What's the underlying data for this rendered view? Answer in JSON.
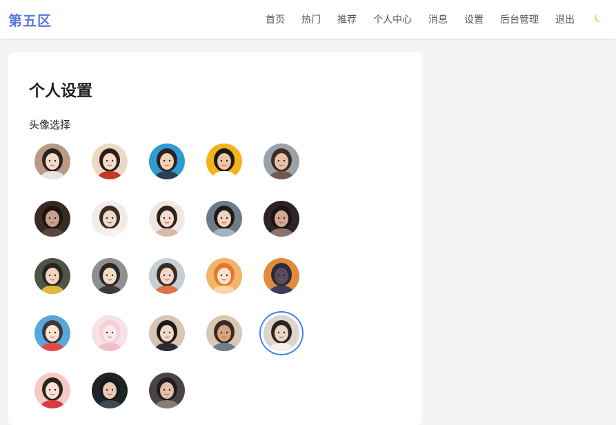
{
  "brand": "第五区",
  "nav": {
    "items": [
      "首页",
      "热门",
      "推荐",
      "个人中心",
      "消息",
      "设置",
      "后台管理",
      "退出"
    ],
    "theme_icon": "moon-icon"
  },
  "settings": {
    "title": "个人设置",
    "avatar_label": "头像选择",
    "selected_index": 19,
    "avatars": [
      {
        "icon": "avatar-girl-illustration",
        "bg": "#b89a86",
        "skin": "#f3dccb",
        "hair": "#2b2220",
        "shirt": "#e8e4e0"
      },
      {
        "icon": "avatar-girl-red-dress",
        "bg": "#ecd9c4",
        "skin": "#f5dcc8",
        "hair": "#2a1f1c",
        "shirt": "#c0392b"
      },
      {
        "icon": "avatar-boy-glasses",
        "bg": "#2f9bd0",
        "skin": "#f1d3b7",
        "hair": "#2a2322",
        "shirt": "#2c3e50"
      },
      {
        "icon": "avatar-man-yellow",
        "bg": "#f4b21b",
        "skin": "#e9c6a5",
        "hair": "#1b1b1b",
        "shirt": "#ffffff"
      },
      {
        "icon": "avatar-selfie",
        "bg": "#9aa1a8",
        "skin": "#e2c3a8",
        "hair": "#3d2b25",
        "shirt": "#6d5a52"
      },
      {
        "icon": "avatar-dark-girl",
        "bg": "#3a2a26",
        "skin": "#c9a190",
        "hair": "#1d1514",
        "shirt": "#5a4641"
      },
      {
        "icon": "avatar-girl-white",
        "bg": "#f2ece9",
        "skin": "#f1d9ca",
        "hair": "#3c2c28",
        "shirt": "#f7f2f0"
      },
      {
        "icon": "avatar-girl-smile",
        "bg": "#f0e6e2",
        "skin": "#f4dcd0",
        "hair": "#2e211e",
        "shirt": "#d7b9ab"
      },
      {
        "icon": "avatar-girl-outdoor",
        "bg": "#6f7c88",
        "skin": "#f0d2bf",
        "hair": "#1c1a1a",
        "shirt": "#a6b3c1"
      },
      {
        "icon": "avatar-girl-shadow",
        "bg": "#2d2423",
        "skin": "#d1aa96",
        "hair": "#1a1413",
        "shirt": "#8c7469"
      },
      {
        "icon": "avatar-girl-yellow",
        "bg": "#4d5548",
        "skin": "#f0d6bd",
        "hair": "#2a2420",
        "shirt": "#e0b93b"
      },
      {
        "icon": "avatar-boy-cartoon",
        "bg": "#8f9191",
        "skin": "#f1dcc8",
        "hair": "#2b2624",
        "shirt": "#3f3a39"
      },
      {
        "icon": "avatar-girl-flowers",
        "bg": "#c6cfd6",
        "skin": "#f2d6c6",
        "hair": "#3a2b25",
        "shirt": "#e0714b"
      },
      {
        "icon": "avatar-girl-orange-hair",
        "bg": "#f2b46b",
        "skin": "#fbe2c8",
        "hair": "#e2782b",
        "shirt": "#f7d7a8"
      },
      {
        "icon": "avatar-sunset",
        "bg": "#e08a3c",
        "skin": "#5a4a5a",
        "hair": "#2c2a3c",
        "shirt": "#3c3d59"
      },
      {
        "icon": "avatar-cartoon-kid",
        "bg": "#5aa7dc",
        "skin": "#fbe3cf",
        "hair": "#3a3a3a",
        "shirt": "#e54848"
      },
      {
        "icon": "avatar-anime-pink",
        "bg": "#f6e1e6",
        "skin": "#fbe9ec",
        "hair": "#f3cfd8",
        "shirt": "#f0c0ca"
      },
      {
        "icon": "avatar-girl-bob",
        "bg": "#d8c6b3",
        "skin": "#f2d8c3",
        "hair": "#1e1a19",
        "shirt": "#2c2c34"
      },
      {
        "icon": "avatar-boy-anime",
        "bg": "#d9c8b4",
        "skin": "#d7a47c",
        "hair": "#3b2a22",
        "shirt": "#6a7e8f"
      },
      {
        "icon": "avatar-guy-white",
        "bg": "#dcd5cf",
        "skin": "#ead4c3",
        "hair": "#2c2320",
        "shirt": "#f3efe9"
      },
      {
        "icon": "avatar-girl-pink-bg",
        "bg": "#f7c9c2",
        "skin": "#fbe1d2",
        "hair": "#2a2320",
        "shirt": "#d63c3c"
      },
      {
        "icon": "avatar-girl-dark-bg",
        "bg": "#1f2427",
        "skin": "#e8c9b4",
        "hair": "#171b1d",
        "shirt": "#3c4a52"
      },
      {
        "icon": "avatar-girl-moody",
        "bg": "#4a4544",
        "skin": "#dec0ab",
        "hair": "#221d1c",
        "shirt": "#8a7b72"
      }
    ]
  }
}
